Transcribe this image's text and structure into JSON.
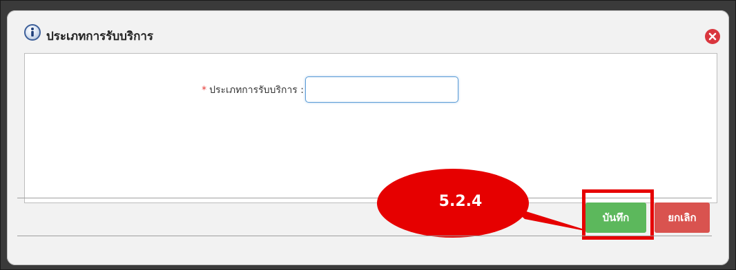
{
  "dialog": {
    "title": "ประเภทการรับบริการ",
    "close_label": "close"
  },
  "form": {
    "required_mark": "*",
    "field_label": "ประเภทการรับบริการ :",
    "field_value": ""
  },
  "buttons": {
    "save_label": "บันทึก",
    "cancel_label": "ยกเลิก"
  },
  "annotation": {
    "step_label": "5.2.4"
  },
  "colors": {
    "save": "#5cb85c",
    "cancel": "#d9534f",
    "close": "#d9363e",
    "callout": "#e60000"
  }
}
